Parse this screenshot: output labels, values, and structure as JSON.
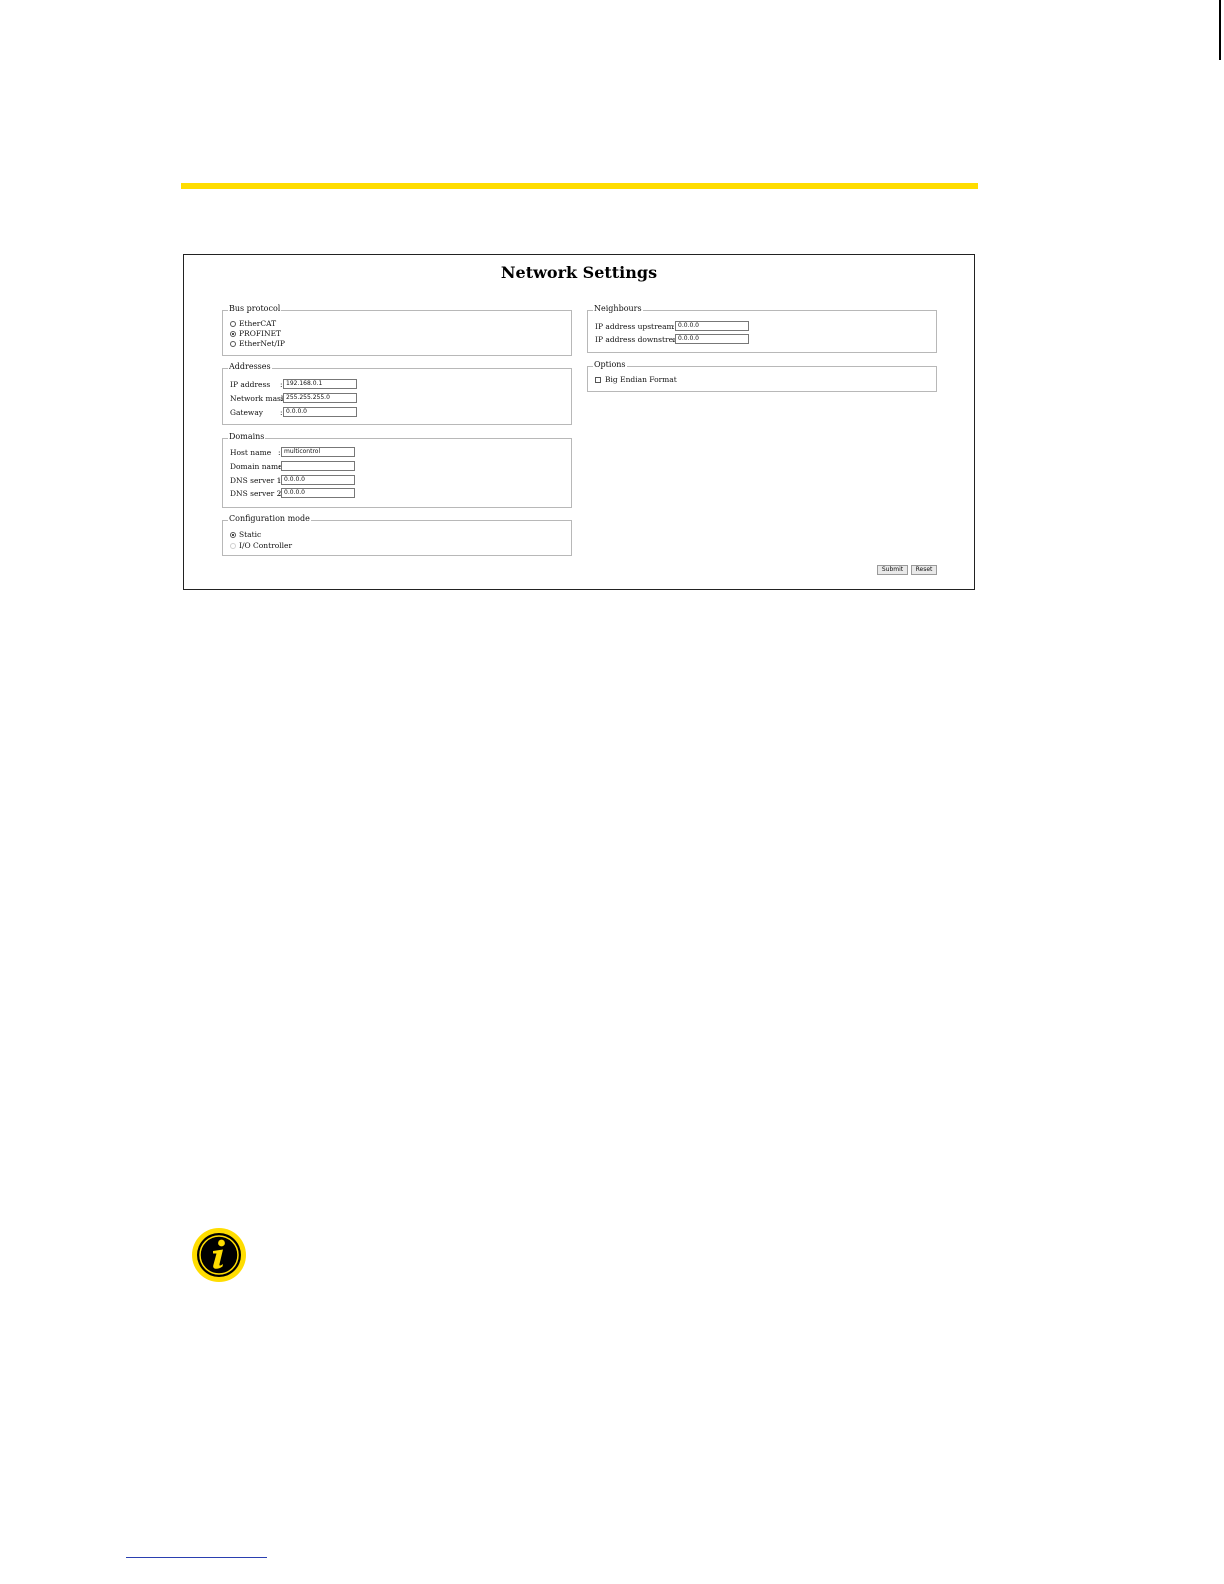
{
  "title": "Network Settings",
  "bus_protocol": {
    "legend": "Bus protocol",
    "options": [
      {
        "label": "EtherCAT",
        "checked": false,
        "disabled": false
      },
      {
        "label": "PROFINET",
        "checked": true,
        "disabled": false
      },
      {
        "label": "EtherNet/IP",
        "checked": false,
        "disabled": false
      }
    ]
  },
  "addresses": {
    "legend": "Addresses",
    "fields": [
      {
        "label": "IP address",
        "sep": ":",
        "value": "192.168.0.1"
      },
      {
        "label": "Network mask",
        "sep": ":",
        "value": "255.255.255.0"
      },
      {
        "label": "Gateway",
        "sep": ":",
        "value": "0.0.0.0"
      }
    ]
  },
  "domains": {
    "legend": "Domains",
    "fields": [
      {
        "label": "Host name",
        "sep": ":",
        "value": "multicontrol"
      },
      {
        "label": "Domain name",
        "sep": ":",
        "value": ""
      },
      {
        "label": "DNS server 1",
        "sep": ":",
        "value": "0.0.0.0"
      },
      {
        "label": "DNS server 2",
        "sep": ":",
        "value": "0.0.0.0"
      }
    ]
  },
  "configuration_mode": {
    "legend": "Configuration mode",
    "options": [
      {
        "label": "Static",
        "checked": true,
        "disabled": false
      },
      {
        "label": "I/O Controller",
        "checked": false,
        "disabled": true
      }
    ]
  },
  "neighbours": {
    "legend": "Neighbours",
    "fields": [
      {
        "label": "IP address upstream",
        "sep": ":",
        "value": "0.0.0.0"
      },
      {
        "label": "IP address downstream",
        "sep": ":",
        "value": "0.0.0.0"
      }
    ]
  },
  "options": {
    "legend": "Options",
    "checkbox_label": "Big Endian Format",
    "checked": false
  },
  "buttons": {
    "submit": "Submit",
    "reset": "Reset"
  },
  "colors": {
    "accent_yellow": "#ffdd00",
    "icon_black": "#000000"
  },
  "icons": [
    "info-icon"
  ]
}
